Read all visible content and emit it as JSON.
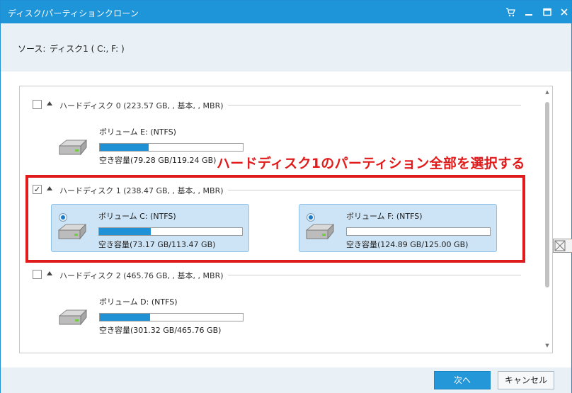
{
  "window": {
    "title": "ディスク/パーティションクローン"
  },
  "titlebar_icons": [
    "cart-icon",
    "minimize-icon",
    "maximize-icon",
    "close-icon"
  ],
  "source": {
    "label": "ソース:",
    "value": "ディスク1 ( C:, F: )"
  },
  "annotation": {
    "text": "ハードディスク1のパーティション全部を選択する",
    "color": "#e11b1b"
  },
  "disks": [
    {
      "title": "ハードディスク 0 (223.57 GB, , 基本, , MBR)",
      "checked": false,
      "volumes": [
        {
          "name": "ボリューム E: (NTFS)",
          "free": "空き容量(79.28 GB/119.24 GB)",
          "used_fraction": 0.34,
          "selected": false
        }
      ]
    },
    {
      "title": "ハードディスク 1 (238.47 GB, , 基本, , MBR)",
      "checked": true,
      "volumes": [
        {
          "name": "ボリューム C: (NTFS)",
          "free": "空き容量(73.17 GB/113.47 GB)",
          "used_fraction": 0.36,
          "selected": true
        },
        {
          "name": "ボリューム F: (NTFS)",
          "free": "空き容量(124.89 GB/125.00 GB)",
          "used_fraction": 0.0,
          "selected": true
        }
      ]
    },
    {
      "title": "ハードディスク 2 (465.76 GB, , 基本, , MBR)",
      "checked": false,
      "volumes": [
        {
          "name": "ボリューム D: (NTFS)",
          "free": "空き容量(301.32 GB/465.76 GB)",
          "used_fraction": 0.35,
          "selected": false
        }
      ]
    }
  ],
  "buttons": {
    "next": "次へ",
    "cancel": "キャンセル"
  },
  "colors": {
    "accent": "#1d95d8",
    "bar_fill": "#1f91d4",
    "selected_bg": "#cde4f6"
  }
}
